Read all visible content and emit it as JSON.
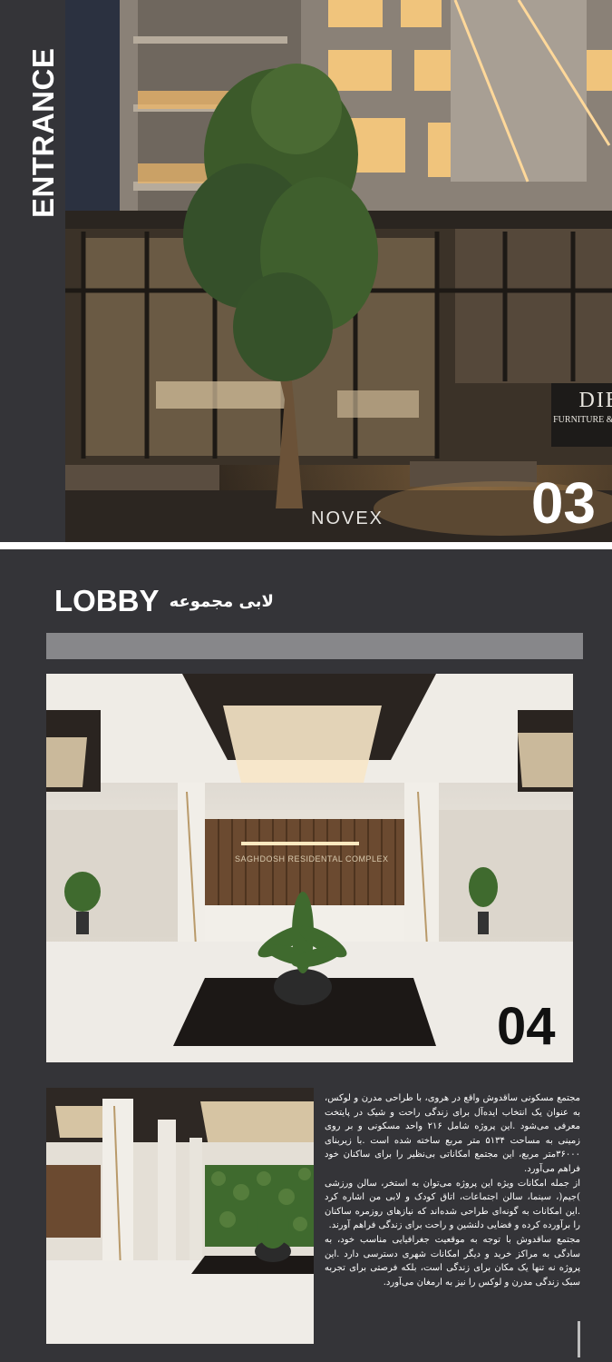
{
  "entrance": {
    "side_label": "ENTRANCE",
    "page_number": "03",
    "logo": "NOVEX",
    "store_sign": {
      "brand": "DIBAJ",
      "subtitle": "FURNITURE & HOME DECOR"
    }
  },
  "lobby": {
    "title_en": "LOBBY",
    "title_fa": "لابی مجموعه",
    "page_number": "04",
    "reception_sign": "SAGHDOSH RESIDENTAL COMPLEX",
    "description": [
      "مجتمع مسکونی ساقدوش واقع در هروی، با طراحی مدرن و لوکس، به عنوان یک انتخاب ایده‌آل برای زندگی راحت و شیک در پایتخت معرفی می‌شود .این پروژه شامل ۲۱۶ واحد مسکونی و بر روی زمینی به مساحت ۵۱۳۴ متر مربع ساخته شده است .با زیربنای ۳۶۰۰۰متر مربع، این مجتمع امکاناتی بی‌نظیر را برای ساکنان خود فراهم می‌آورد.",
      "از جمله امکانات ویژه این پروژه می‌توان به استخر، سالن ورزشی )جیم(، سینما، سالن اجتماعات، اتاق کودک و لابی من اشاره کرد .این امکانات به گونه‌ای طراحی شده‌اند که نیازهای روزمره ساکنان را برآورده کرده و فضایی دلنشین و راحت برای زندگی فراهم آورند.",
      "مجتمع ساقدوش با توجه به موقعیت جغرافیایی مناسب خود، به سادگی به مراکز خرید و دیگر امکانات شهری دسترسی دارد .این پروژه نه تنها یک مکان برای زندگی است، بلکه فرصتی برای تجربه سبک زندگی مدرن و لوکس را نیز به ارمغان می‌آورد."
    ]
  }
}
